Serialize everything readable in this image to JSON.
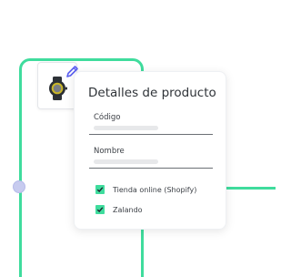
{
  "colors": {
    "accent": "#3fdc9d",
    "edit_icon": "#5b5ff0"
  },
  "product_card": {
    "title": "Detalles de producto",
    "fields": [
      {
        "label": "Código"
      },
      {
        "label": "Nombre"
      }
    ],
    "channels": [
      {
        "label": "Tienda online (Shopify)",
        "checked": true
      },
      {
        "label": "Zalando",
        "checked": true
      }
    ]
  },
  "icons": {
    "thumbnail": "watch-icon",
    "edit": "pencil-icon",
    "check": "checkmark-icon"
  }
}
